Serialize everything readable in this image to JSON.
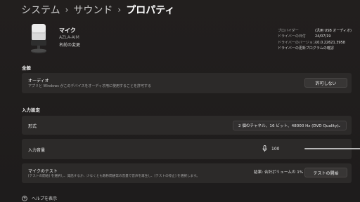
{
  "breadcrumb": [
    "システム",
    "サウンド",
    "プロパティ"
  ],
  "breadcrumb_sep": "›",
  "device": {
    "name": "マイク",
    "model": "AZLA-AIM",
    "rename_label": "名前の変更"
  },
  "driver": {
    "provider_label": "プロバイダー",
    "provider_value": "(汎用 USB オーディオ)",
    "date_label": "ドライバーの日付",
    "date_value": "24/07/19",
    "version_label": "ドライバーのバージョン",
    "version_value": "10.0.22621.3958",
    "check_updates": "ドライバーの更新プログラムの確認"
  },
  "general": {
    "title": "全般",
    "audio_title": "オーディオ",
    "audio_desc": "アプリと Windows がこのデバイスをオーディオ用に使用することを許可する",
    "disallow_button": "許可しない"
  },
  "input": {
    "title": "入力設定",
    "format_label": "形式",
    "format_value": "2 個のチャネル、16 ビット、48000 Hz (DVD Quality)",
    "volume_label": "入力音量",
    "volume_value": "100",
    "volume_fraction": 1.0,
    "test_title": "マイクのテスト",
    "test_desc": "[テストの開始] を選択し、発話するか、少なくとも数秒間通常の音量で音声を再生し、[テストの停止] を選択します。",
    "test_result": "結果: 合計ボリュームの 1%",
    "test_button": "テストの開始"
  },
  "help_label": "ヘルプを表示",
  "icons": {
    "chevron_down": "chevron-down-icon",
    "mic": "microphone-icon",
    "help": "help-icon"
  }
}
